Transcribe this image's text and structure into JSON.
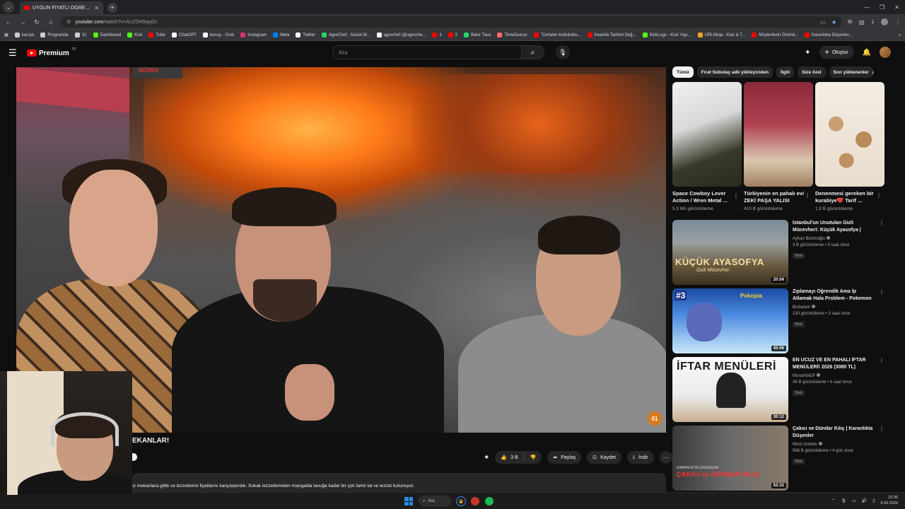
{
  "browser": {
    "tab_title": "UYGUN FİYATLI ÖĞRENCİ DOSTU",
    "url_host": "youtube.com",
    "url_path": "/watch?v=AUZDH5qvjZc",
    "bookmarks": [
      {
        "label": "karışık",
        "color": "#cfcfcf"
      },
      {
        "label": "Programlar",
        "color": "#cfcfcf"
      },
      {
        "label": "31",
        "color": "#cfcfcf"
      },
      {
        "label": "Dashboard",
        "color": "#53fc18"
      },
      {
        "label": "Kick",
        "color": "#53fc18"
      },
      {
        "label": "Tube",
        "color": "#ff0000"
      },
      {
        "label": "ChatGPT",
        "color": "#ffffff"
      },
      {
        "label": "konuş - Grok",
        "color": "#ffffff"
      },
      {
        "label": "Instagram",
        "color": "#e1306c"
      },
      {
        "label": "Meta",
        "color": "#0081fb"
      },
      {
        "label": "Twitter",
        "color": "#ffffff"
      },
      {
        "label": "AgreChef - Social M...",
        "color": "#25d366"
      },
      {
        "label": "agrechef (@agreche...",
        "color": "#ffffff"
      },
      {
        "label": "1",
        "color": "#ff0000"
      },
      {
        "label": "2",
        "color": "#ff0000"
      },
      {
        "label": "Bakır Tava",
        "color": "#25d366"
      },
      {
        "label": "TimeGuessr",
        "color": "#ff6b6b"
      },
      {
        "label": "\"Cehalet mutluluktu...",
        "color": "#ff0000"
      },
      {
        "label": "İnsanlık Tarihini Değ...",
        "color": "#ff0000"
      },
      {
        "label": "KickLogs - Kick Yayı...",
        "color": "#53fc18"
      },
      {
        "label": "URLNinja - Kick & T...",
        "color": "#f5a623"
      },
      {
        "label": "Müşterilerin Önünd...",
        "color": "#ff0000"
      },
      {
        "label": "Karanlıkta Düşenler...",
        "color": "#ff0000"
      }
    ],
    "bookmarks_more": "»"
  },
  "yt_header": {
    "brand": "Premium",
    "country": "TR",
    "search_placeholder": "Ara",
    "create_label": "Oluştur"
  },
  "video": {
    "title_fragment": "EKANLAR!",
    "watermark": "01",
    "like_count": "3 B",
    "share_label": "Paylaş",
    "save_label": "Kaydet",
    "download_label": "İndir",
    "description": "ız mekanlara gittik ve lezzetlerini fiyatlarını karşılaştırdık. Sokak lezzetlerinden mangalda tavuğa kadar bir çok farklı tat ve lezzet bulunuyor.",
    "bakery_sign": "BÖREK"
  },
  "chips": [
    "Tümü",
    "Fırat Sobutay adlı yükleyiciden",
    "İlgili",
    "Size özel",
    "Son yüklenenler"
  ],
  "shorts": [
    {
      "title": "Space Cowboy Lever Action / Wren Metal ...",
      "views": "5,3 Mn görüntüleme"
    },
    {
      "title": "Türkiyenin en pahalı evi ZEKİ PAŞA YALISI",
      "views": "410 B görüntüleme"
    },
    {
      "title": "Denenmesi gereken bir kurabiye❤️ Tarif ...",
      "views": "1,9 B görüntüleme"
    }
  ],
  "recommendations": [
    {
      "title": "İstanbul'un Unutulan Gizli Mücevheri: Küçük Ayasofya | Seninle On Dakika ...",
      "channel": "Ayhan Bicilmoğlu",
      "meta": "3 B görüntüleme • 3 saat önce",
      "badge": "Yeni",
      "duration": "20:04",
      "thumb_text": "KÜÇÜK AYASOFYA",
      "thumb_sub": "Gizli Mücevher"
    },
    {
      "title": "Zıplamayı Öğrendik Ama İp Atlamak Hala Problem - Pokemon Pokopia ...",
      "channel": "Bizbatark",
      "meta": "130 görüntüleme • 3 saat önce",
      "badge": "Yeni",
      "duration": "45:06",
      "thumb_text": "#3",
      "thumb_sub": "Pokopia"
    },
    {
      "title": "EN UCUZ VE EN PAHALI İFTAR MENÜLERİ! 2026 (3080 TL)",
      "channel": "MuratAbiGF",
      "meta": "36 B görüntüleme • 4 saat önce",
      "badge": "Yeni",
      "duration": "30:12",
      "thumb_text": "İFTAR MENÜLERİ",
      "thumb_sub": ""
    },
    {
      "title": "Çakıcı ve Dündar Kılıç | Karanlıkta Düşenler",
      "channel": "Mind Vortekx",
      "meta": "566 B görüntüleme • 4 gün önce",
      "badge": "Yeni",
      "duration": "52:31",
      "thumb_text": "ÇAKICI ve DÜNDAR KILIÇ",
      "thumb_sub": "KARANLIKTA DÜŞENLER"
    }
  ],
  "taskbar": {
    "search_label": "Ara",
    "time": "22:35",
    "date": "6.03.2026"
  }
}
